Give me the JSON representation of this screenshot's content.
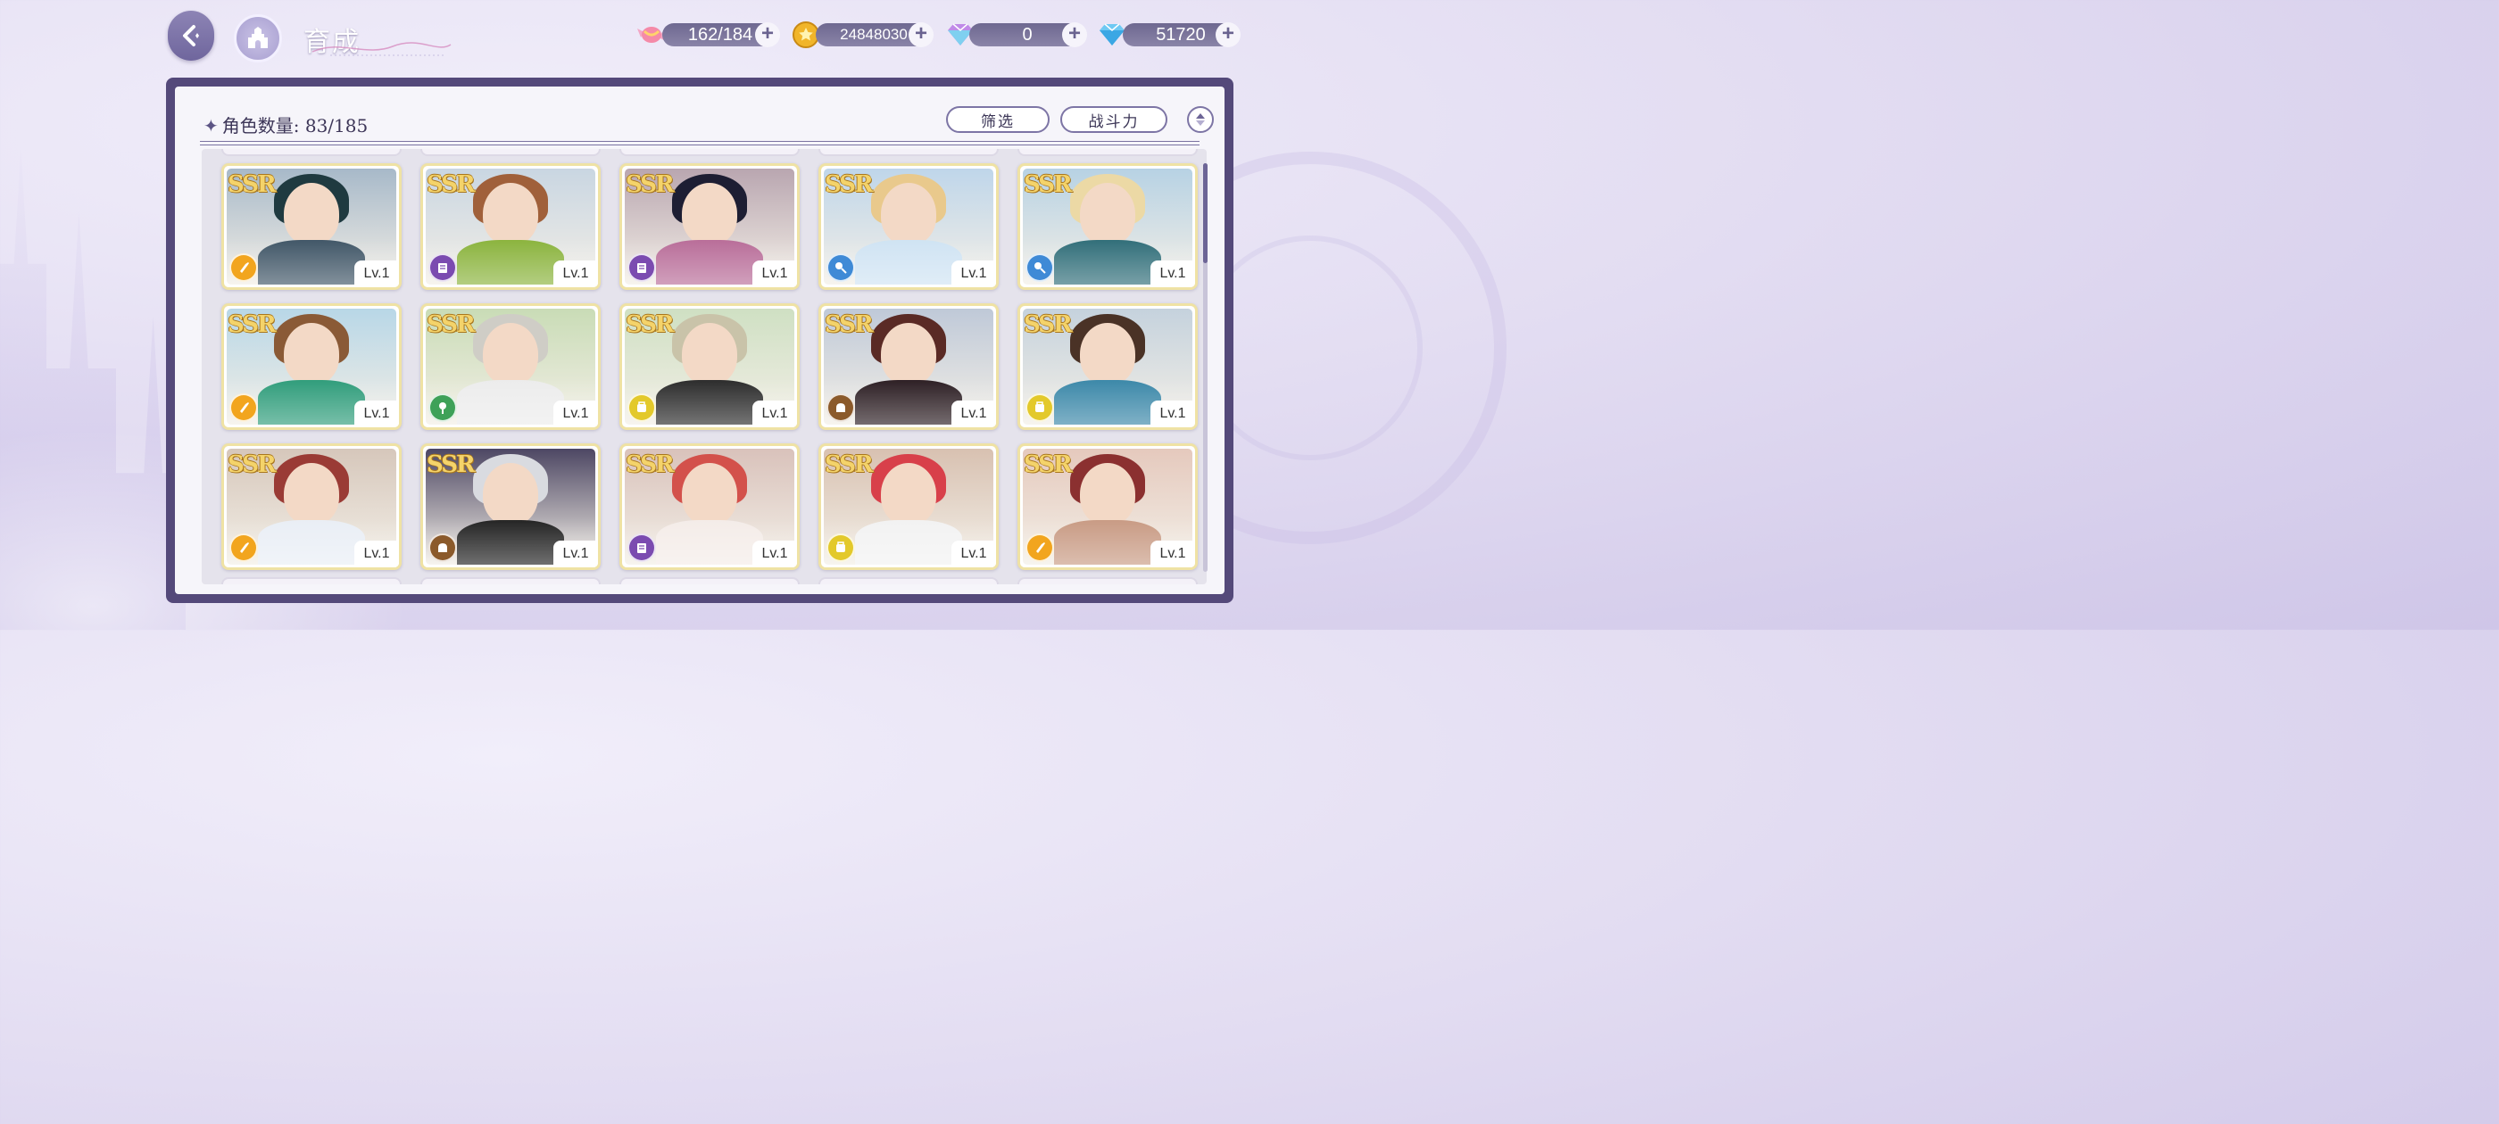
{
  "header": {
    "title": "育成",
    "resources": [
      {
        "name": "candy",
        "value": "162/184",
        "icon": "candy-icon"
      },
      {
        "name": "gold",
        "value": "24848030",
        "icon": "gold-coin-icon"
      },
      {
        "name": "rainbow_gem",
        "value": "0",
        "icon": "rainbow-gem-icon"
      },
      {
        "name": "diamond",
        "value": "51720",
        "icon": "diamond-icon"
      }
    ],
    "plus_label": "+"
  },
  "panel": {
    "count_label": "角色数量: 83/185",
    "filter_label": "筛选",
    "sort_label": "战斗力"
  },
  "cards": [
    {
      "rarity": "SSR",
      "level": "Lv.1",
      "element": "orange",
      "hair": "#1f3a40",
      "bg": "#a7b9c9",
      "outfit": "#3f5566"
    },
    {
      "rarity": "SSR",
      "level": "Lv.1",
      "element": "purple",
      "hair": "#a0603a",
      "bg": "#c9d6e2",
      "outfit": "#8ab33c"
    },
    {
      "rarity": "SSR",
      "level": "Lv.1",
      "element": "purple",
      "hair": "#1d1e33",
      "bg": "#b9a6b0",
      "outfit": "#b86c98"
    },
    {
      "rarity": "SSR",
      "level": "Lv.1",
      "element": "blue",
      "hair": "#e9c98c",
      "bg": "#bfd6ea",
      "outfit": "#cfe3f3"
    },
    {
      "rarity": "SSR",
      "level": "Lv.1",
      "element": "blue",
      "hair": "#ecd9a5",
      "bg": "#b7d2e4",
      "outfit": "#2f6d78"
    },
    {
      "rarity": "SSR",
      "level": "Lv.1",
      "element": "orange",
      "hair": "#8a5a36",
      "bg": "#b8d7e7",
      "outfit": "#2e9c7a"
    },
    {
      "rarity": "SSR",
      "level": "Lv.1",
      "element": "green",
      "hair": "#cfcdc6",
      "bg": "#c9dcb6",
      "outfit": "#ececec"
    },
    {
      "rarity": "SSR",
      "level": "Lv.1",
      "element": "yellow",
      "hair": "#c9c3a9",
      "bg": "#cfe0c3",
      "outfit": "#2a2a2a"
    },
    {
      "rarity": "SSR",
      "level": "Lv.1",
      "element": "brown",
      "hair": "#5a2a25",
      "bg": "#bfc9d8",
      "outfit": "#2b1d22"
    },
    {
      "rarity": "SSR",
      "level": "Lv.1",
      "element": "yellow",
      "hair": "#4a3226",
      "bg": "#c5d2dd",
      "outfit": "#3a87a8"
    },
    {
      "rarity": "SSR",
      "level": "Lv.1",
      "element": "orange",
      "hair": "#9a3b35",
      "bg": "#d6c7bb",
      "outfit": "#e9eef5"
    },
    {
      "rarity": "SSR",
      "level": "Lv.1",
      "element": "brown",
      "hair": "#d9dbe0",
      "bg": "#4d4763",
      "outfit": "#222"
    },
    {
      "rarity": "SSR",
      "level": "Lv.1",
      "element": "purple",
      "hair": "#d3514b",
      "bg": "#d9c2bb",
      "outfit": "#f4ece8"
    },
    {
      "rarity": "SSR",
      "level": "Lv.1",
      "element": "yellow",
      "hair": "#d8404a",
      "bg": "#d8c1b1",
      "outfit": "#f2f2f2"
    },
    {
      "rarity": "SSR",
      "level": "Lv.1",
      "element": "orange",
      "hair": "#8b3030",
      "bg": "#e5c9bd",
      "outfit": "#c89a83"
    }
  ],
  "element_colors": {
    "orange": "#f2a51e",
    "purple": "#7b4bb0",
    "blue": "#3f8ad6",
    "green": "#3ea158",
    "yellow": "#e3c92b",
    "brown": "#8b5a2b"
  }
}
